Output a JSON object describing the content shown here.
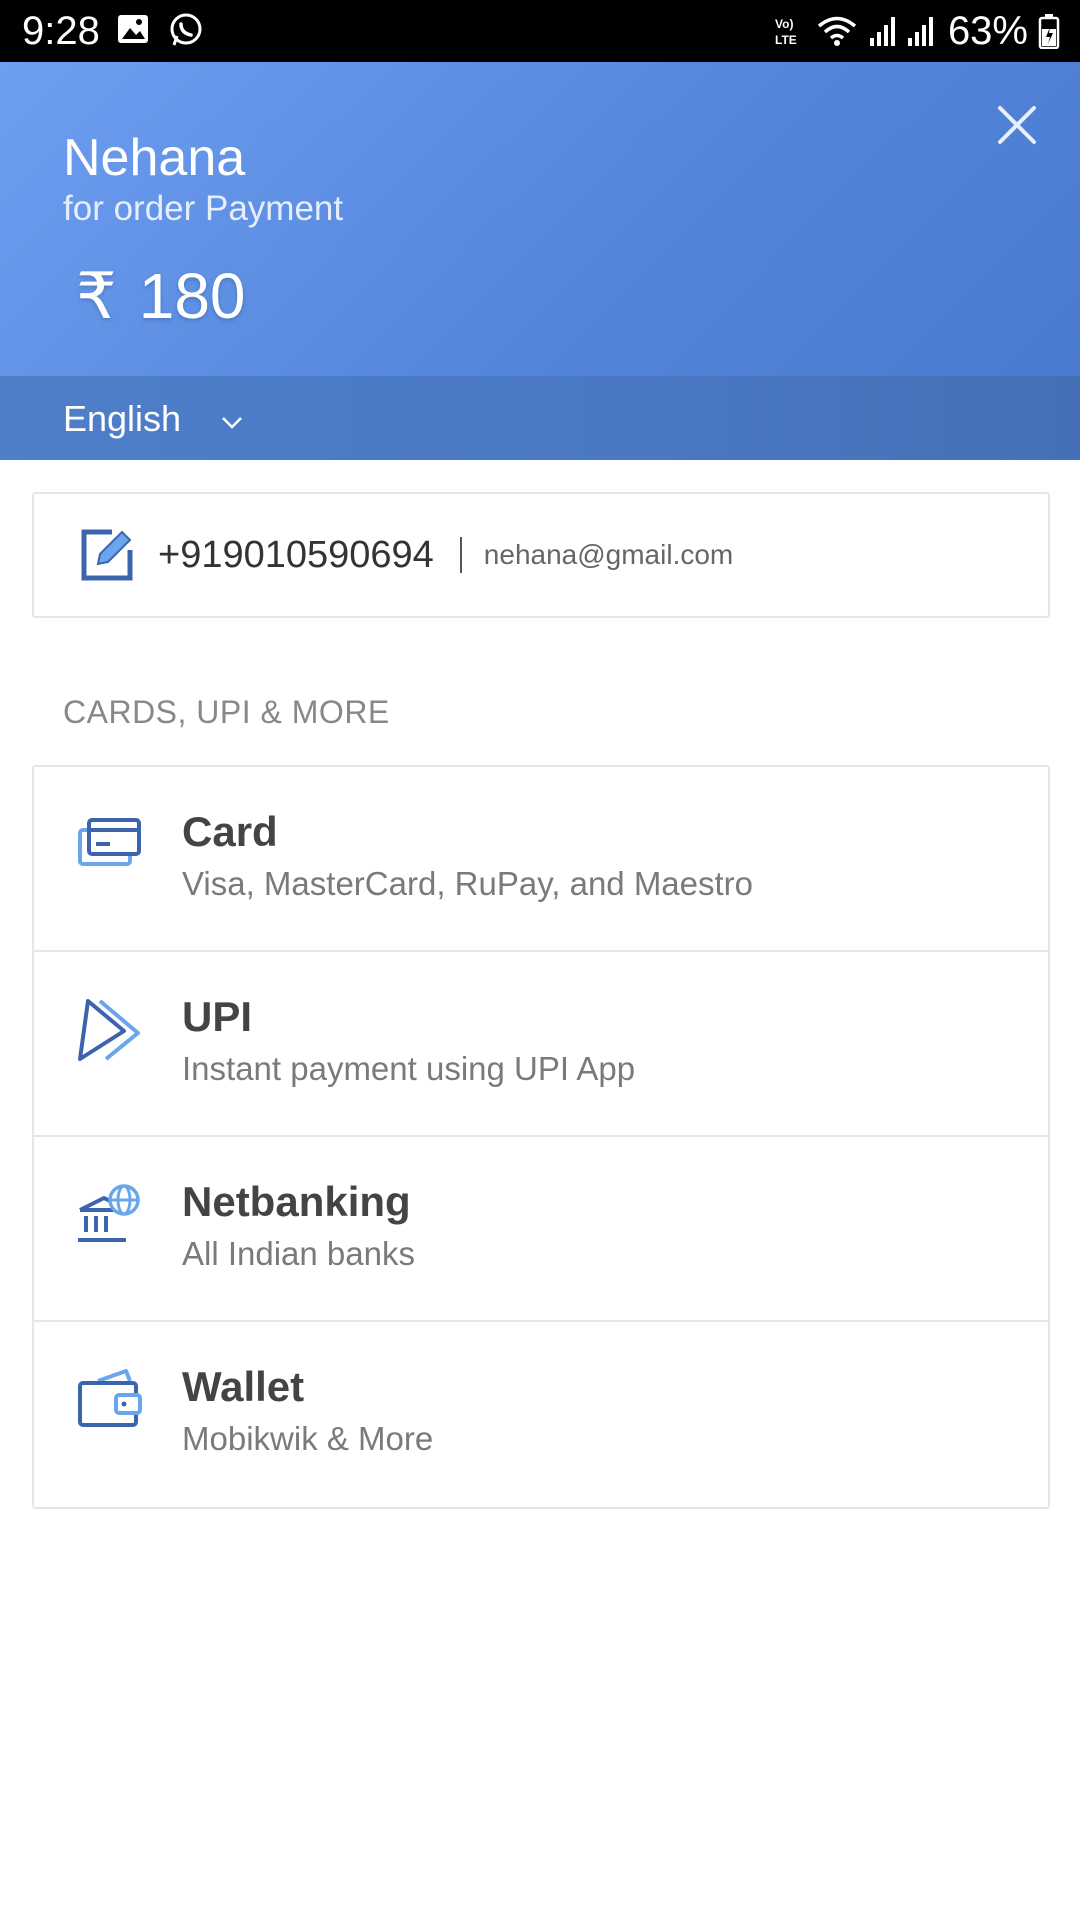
{
  "status_bar": {
    "time": "9:28",
    "battery_percent": "63%",
    "icons": [
      "gallery-icon",
      "whatsapp-icon",
      "volte-icon",
      "wifi-icon",
      "signal-icon",
      "signal-icon",
      "battery-icon"
    ]
  },
  "header": {
    "merchant_name": "Nehana",
    "description": "for order Payment",
    "currency_symbol": "₹",
    "amount": "180",
    "close_icon": "close-icon"
  },
  "language": {
    "selected": "English"
  },
  "contact": {
    "phone": "+919010590694",
    "email": "nehana@gmail.com"
  },
  "section": {
    "title": "CARDS, UPI & MORE"
  },
  "methods": [
    {
      "title": "Card",
      "subtitle": "Visa, MasterCard, RuPay, and Maestro",
      "icon": "card-icon"
    },
    {
      "title": "UPI",
      "subtitle": "Instant payment using UPI App",
      "icon": "upi-icon"
    },
    {
      "title": "Netbanking",
      "subtitle": "All Indian banks",
      "icon": "bank-icon"
    },
    {
      "title": "Wallet",
      "subtitle": "Mobikwik & More",
      "icon": "wallet-icon"
    }
  ],
  "colors": {
    "header_blue": "#5b8ee2",
    "lang_bar_blue": "#4a78c2",
    "icon_dark_blue": "#3c64ad",
    "icon_light_blue": "#6aa6ec"
  }
}
